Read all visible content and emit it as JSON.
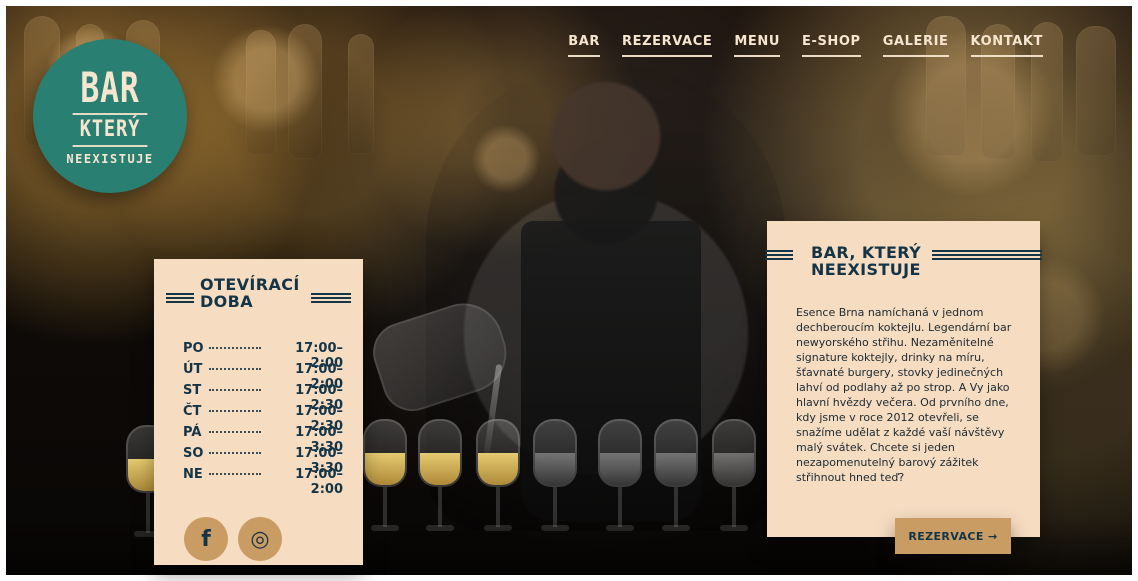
{
  "branding": {
    "logo_line1": "BAR",
    "logo_line2": "KTERÝ",
    "logo_line3": "NEEXISTUJE"
  },
  "nav": {
    "items": [
      {
        "label": "BAR"
      },
      {
        "label": "REZERVACE"
      },
      {
        "label": "MENU"
      },
      {
        "label": "E-SHOP"
      },
      {
        "label": "GALERIE"
      },
      {
        "label": "KONTAKT"
      }
    ]
  },
  "hours": {
    "title_line1": "OTEVÍRACÍ",
    "title_line2": "DOBA",
    "rows": [
      {
        "day": "PO",
        "time": "17:00–2:00"
      },
      {
        "day": "ÚT",
        "time": "17:00–2:00"
      },
      {
        "day": "ST",
        "time": "17:00–2:30"
      },
      {
        "day": "ČT",
        "time": "17:00–2:30"
      },
      {
        "day": "PÁ",
        "time": "17:00–3:30"
      },
      {
        "day": "SO",
        "time": "17:00–3:30"
      },
      {
        "day": "NE",
        "time": "17:00–2:00"
      }
    ],
    "social": [
      {
        "icon": "facebook-icon",
        "glyph": "f"
      },
      {
        "icon": "instagram-icon",
        "glyph": "◎"
      }
    ]
  },
  "about": {
    "title_line1": "BAR, KTERÝ",
    "title_line2": "NEEXISTUJE",
    "text": "Esence Brna namíchaná v jednom dechberoucím koktejlu. Legendární bar newyorského střihu. Nezaměnitelné signature koktejly, drinky na míru, šťavnaté burgery, stovky jedinečných lahví od podlahy až po strop. A Vy jako hlavní hvězdy večera. Od prvního dne, kdy jsme v roce 2012 otevřeli, se snažíme udělat z každé vaší návštěvy malý svátek. Chcete si jeden nezapomenutelný barový zážitek střihnout hned teď?",
    "cta": "REZERVACE →"
  },
  "colors": {
    "teal": "#2a7f73",
    "cream": "#f6dcc1",
    "navy": "#143447",
    "gold": "#c99c63"
  }
}
